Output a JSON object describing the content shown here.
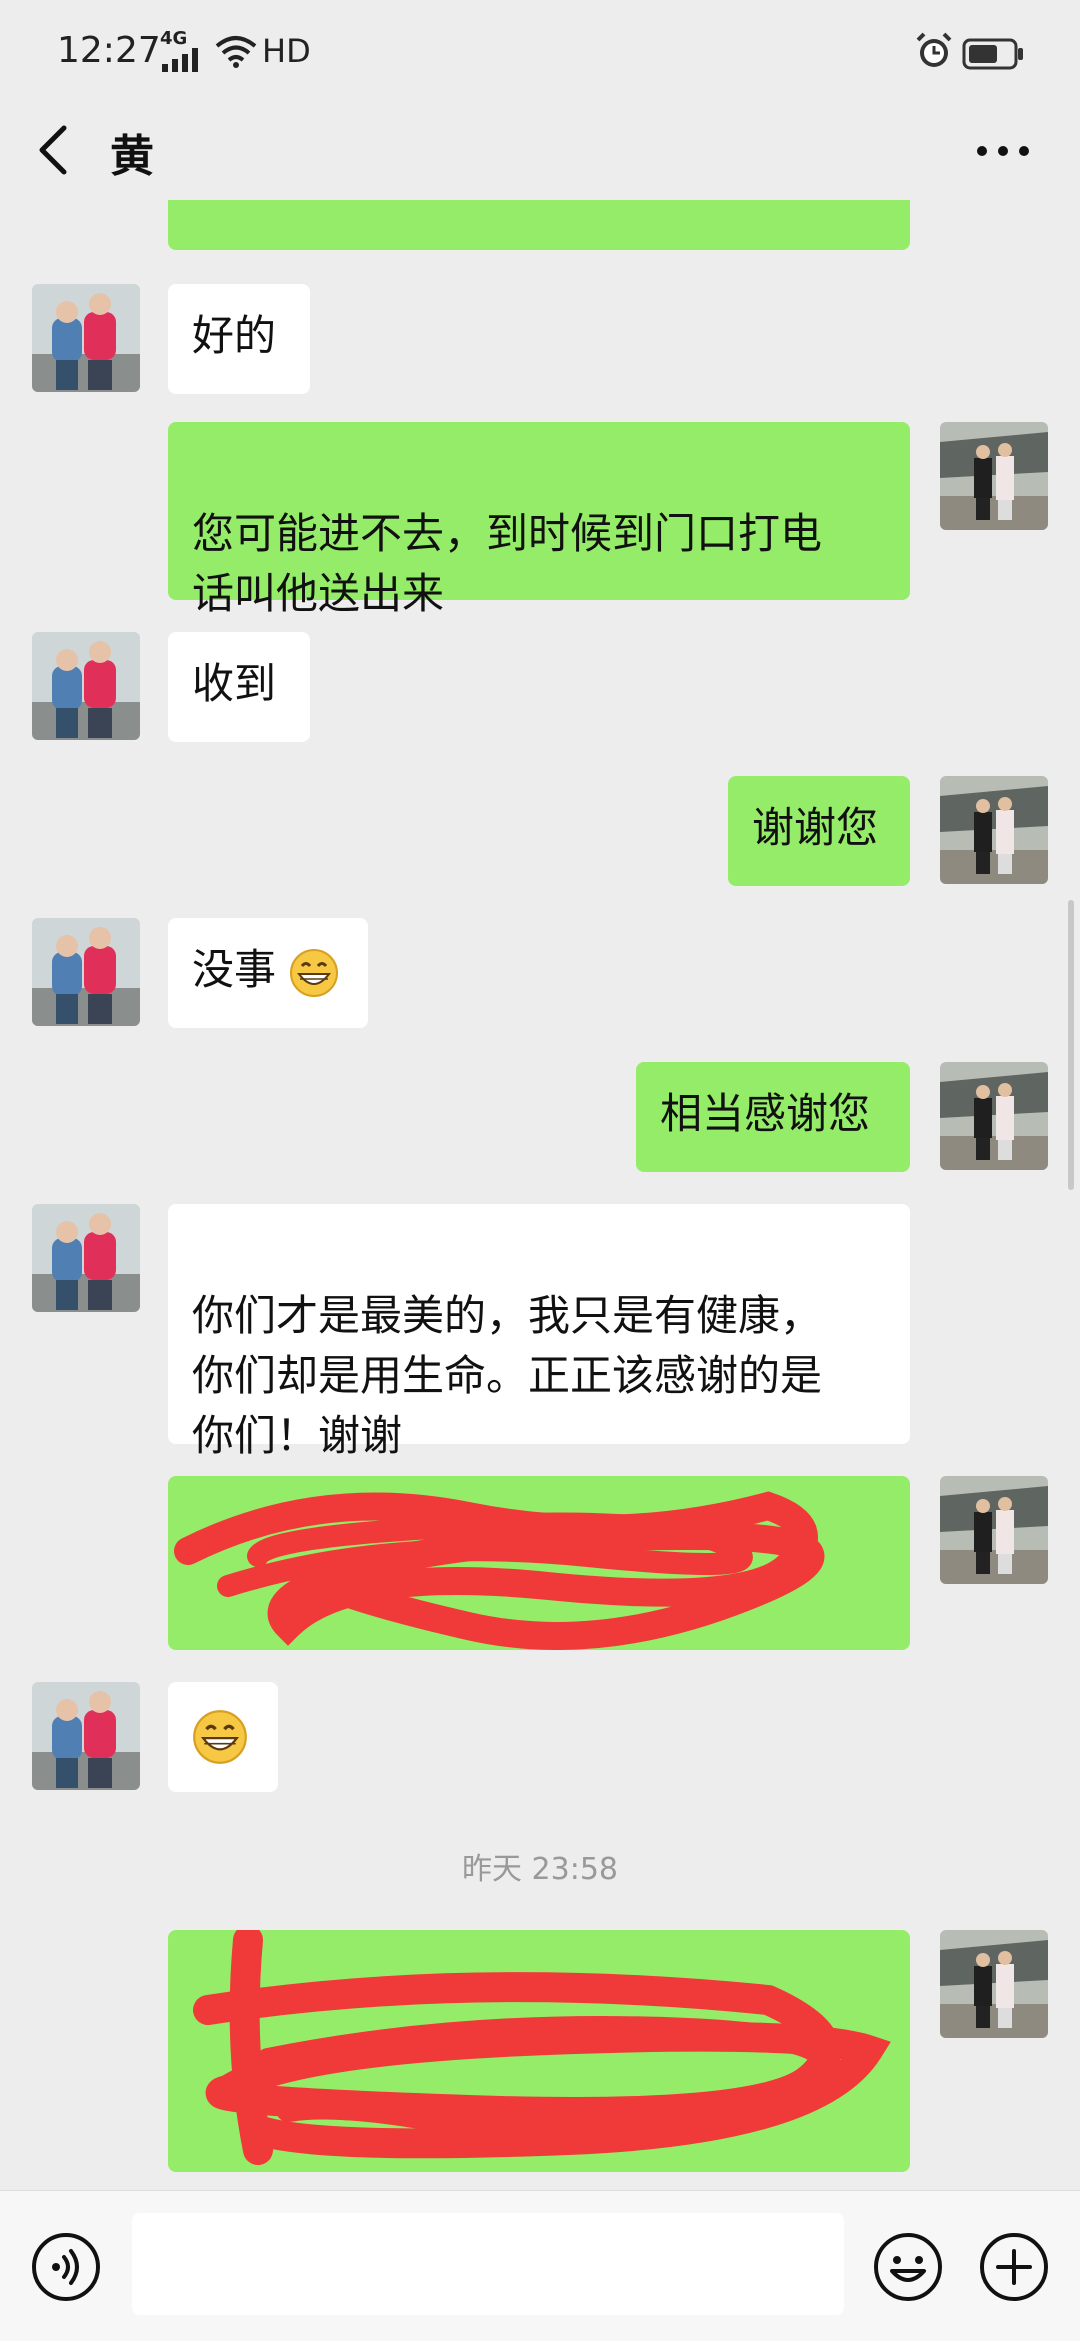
{
  "status_bar": {
    "time": "12:27",
    "network": "4G",
    "hd": "HD"
  },
  "header": {
    "title": "黄"
  },
  "messages": [
    {
      "side": "out",
      "text": ""
    },
    {
      "side": "in",
      "text": "好的"
    },
    {
      "side": "out",
      "text": "您可能进不去，到时候到门口打电\n话叫他送出来"
    },
    {
      "side": "in",
      "text": "收到"
    },
    {
      "side": "out",
      "text": "谢谢您"
    },
    {
      "side": "in",
      "text": "没事"
    },
    {
      "side": "out",
      "text": "相当感谢您"
    },
    {
      "side": "in",
      "text": "你们才是最美的，我只是有健康，\n你们却是用生命。正正该感谢的是\n你们！谢谢"
    },
    {
      "side": "out",
      "text": "",
      "redacted": true
    },
    {
      "side": "in",
      "text": "",
      "emoji": "grin"
    }
  ],
  "timestamp": "昨天 23:58",
  "last_message": {
    "side": "out",
    "text": "",
    "redacted": true
  },
  "input": {
    "placeholder": ""
  },
  "colors": {
    "bubble_out": "#95ec69",
    "bubble_in": "#ffffff",
    "background": "#ededed",
    "redaction": "#f03a3a"
  },
  "icons": [
    "back-icon",
    "more-icon",
    "voice-icon",
    "emoji-icon",
    "plus-icon"
  ]
}
